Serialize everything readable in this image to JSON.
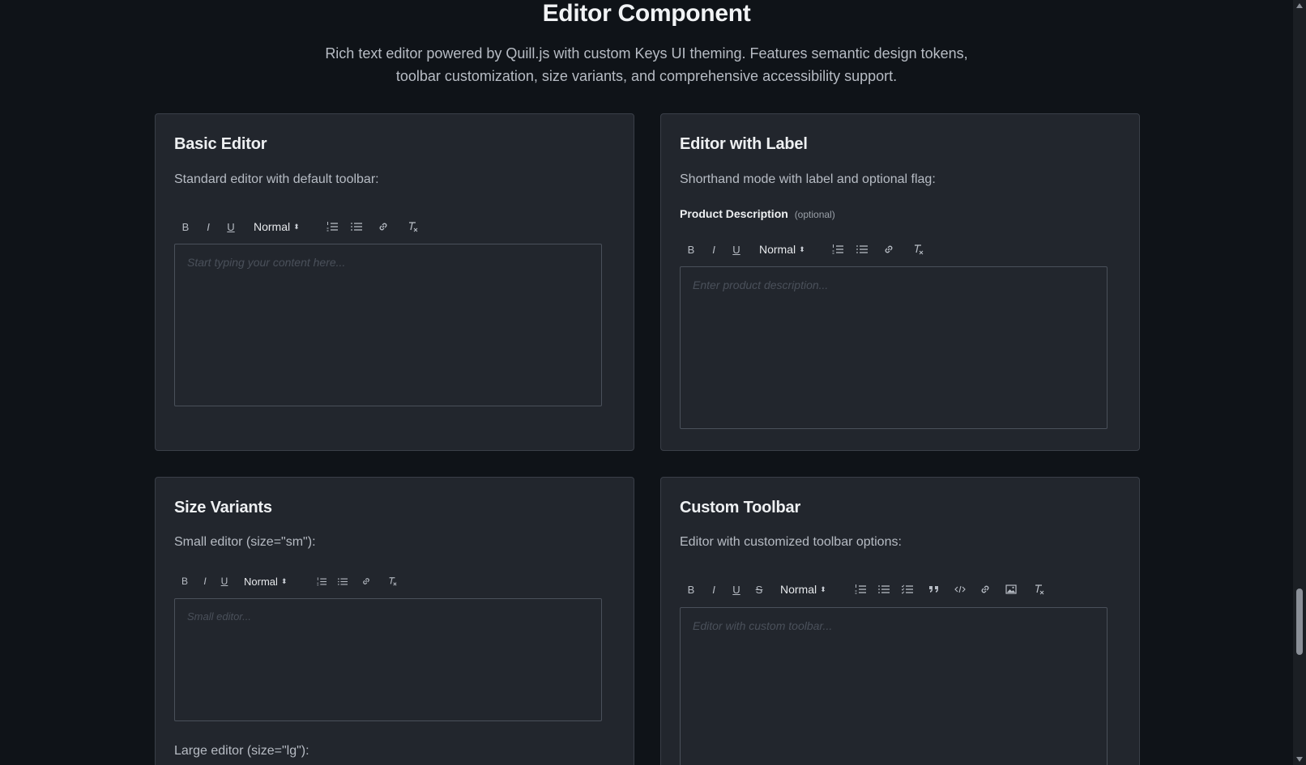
{
  "page": {
    "title": "Editor Component",
    "description": "Rich text editor powered by Quill.js with custom Keys UI theming. Features semantic design tokens, toolbar customization, size variants, and comprehensive accessibility support."
  },
  "toolbar": {
    "bold": "B",
    "italic": "I",
    "underline": "U",
    "strike": "S",
    "header_select": "Normal",
    "header_caret": "⬍"
  },
  "cards": {
    "basic": {
      "title": "Basic Editor",
      "description": "Standard editor with default toolbar:",
      "placeholder": "Start typing your content here..."
    },
    "label": {
      "title": "Editor with Label",
      "description": "Shorthand mode with label and optional flag:",
      "field_label": "Product Description",
      "optional": "(optional)",
      "placeholder": "Enter product description..."
    },
    "sizes": {
      "title": "Size Variants",
      "small_desc": "Small editor (size=\"sm\"):",
      "small_placeholder": "Small editor...",
      "large_desc": "Large editor (size=\"lg\"):"
    },
    "custom": {
      "title": "Custom Toolbar",
      "description": "Editor with customized toolbar options:",
      "placeholder": "Editor with custom toolbar..."
    }
  },
  "colors": {
    "background": "#0f1318",
    "card": "#22262d",
    "border": "#3a3f48",
    "text": "#e6e8eb",
    "muted": "#b7bcc4"
  }
}
